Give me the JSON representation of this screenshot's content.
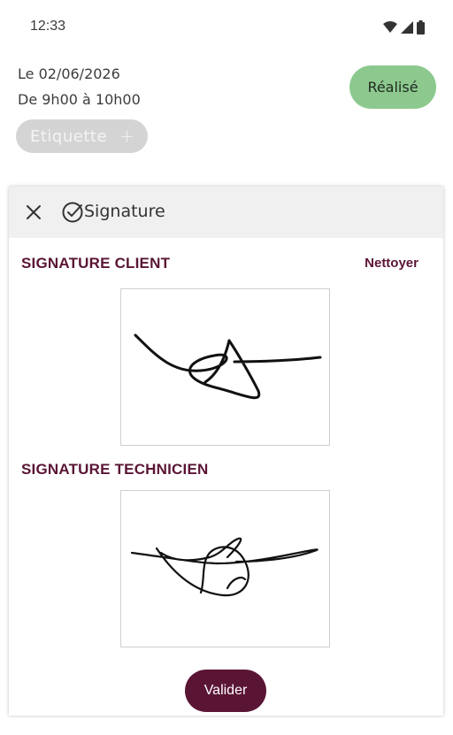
{
  "status_bar": {
    "time": "12:33",
    "icons": [
      "wifi-icon",
      "signal-icon",
      "battery-icon"
    ]
  },
  "appointment": {
    "date": "Le 02/06/2026",
    "time_range": "De 9h00 à 10h00",
    "status": "Réalisé",
    "label_chip": "Etiquette",
    "label_add": "+"
  },
  "dialog": {
    "title": "Signature",
    "client_section": "SIGNATURE CLIENT",
    "clear_label": "Nettoyer",
    "technician_section": "SIGNATURE TECHNICIEN",
    "validate_label": "Valider"
  },
  "colors": {
    "accent": "#5a1535",
    "status_green": "#8dc98f",
    "chip_grey": "#d4d4d4",
    "header_bg": "#f0f0f0"
  }
}
